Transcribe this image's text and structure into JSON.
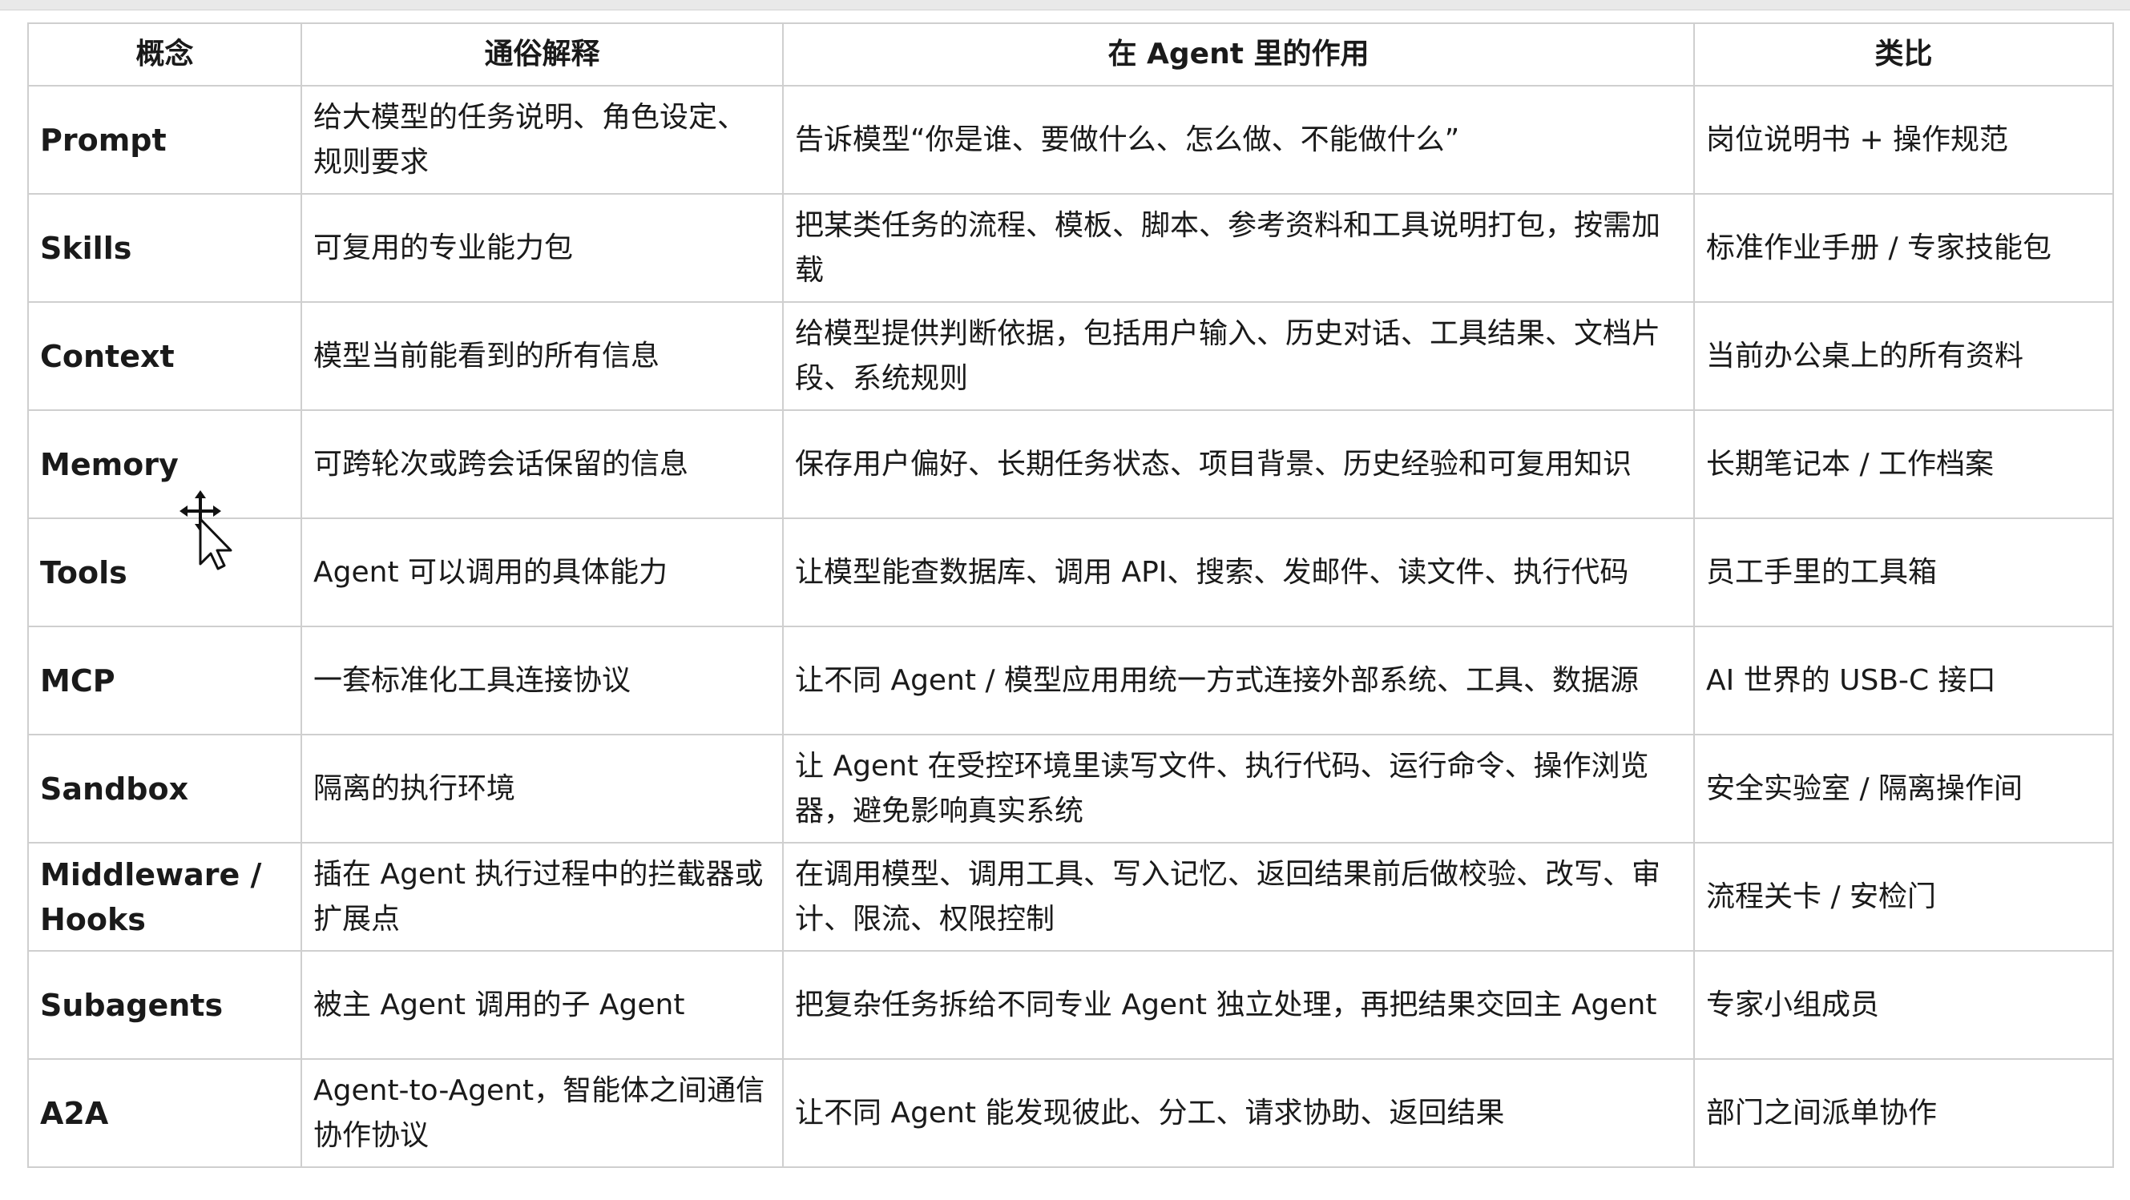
{
  "table": {
    "headers": [
      "概念",
      "通俗解释",
      "在 Agent 里的作用",
      "类比"
    ],
    "rows": [
      [
        "Prompt",
        "给大模型的任务说明、角色设定、规则要求",
        "告诉模型“你是谁、要做什么、怎么做、不能做什么”",
        "岗位说明书 + 操作规范"
      ],
      [
        "Skills",
        "可复用的专业能力包",
        "把某类任务的流程、模板、脚本、参考资料和工具说明打包，按需加载",
        "标准作业手册 / 专家技能包"
      ],
      [
        "Context",
        "模型当前能看到的所有信息",
        "给模型提供判断依据，包括用户输入、历史对话、工具结果、文档片段、系统规则",
        "当前办公桌上的所有资料"
      ],
      [
        "Memory",
        "可跨轮次或跨会话保留的信息",
        "保存用户偏好、长期任务状态、项目背景、历史经验和可复用知识",
        "长期笔记本 / 工作档案"
      ],
      [
        "Tools",
        "Agent 可以调用的具体能力",
        "让模型能查数据库、调用 API、搜索、发邮件、读文件、执行代码",
        "员工手里的工具箱"
      ],
      [
        "MCP",
        "一套标准化工具连接协议",
        "让不同 Agent / 模型应用用统一方式连接外部系统、工具、数据源",
        "AI 世界的 USB-C 接口"
      ],
      [
        "Sandbox",
        "隔离的执行环境",
        "让 Agent 在受控环境里读写文件、执行代码、运行命令、操作浏览器，避免影响真实系统",
        "安全实验室 / 隔离操作间"
      ],
      [
        "Middleware / Hooks",
        "插在 Agent 执行过程中的拦截器或扩展点",
        "在调用模型、调用工具、写入记忆、返回结果前后做校验、改写、审计、限流、权限控制",
        "流程关卡 / 安检门"
      ],
      [
        "Subagents",
        "被主 Agent 调用的子 Agent",
        "把复杂任务拆给不同专业 Agent 独立处理，再把结果交回主 Agent",
        "专家小组成员"
      ],
      [
        "A2A",
        "Agent-to-Agent，智能体之间通信协作协议",
        "让不同 Agent 能发现彼此、分工、请求协助、返回结果",
        "部门之间派单协作"
      ]
    ]
  },
  "cursor": {
    "icon": "move-arrow-cursor-icon"
  }
}
